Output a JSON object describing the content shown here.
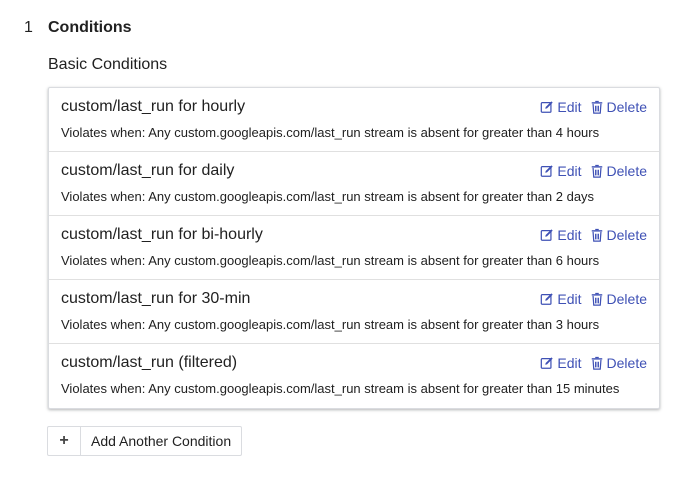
{
  "section": {
    "number": "1",
    "title": "Conditions"
  },
  "subheading": "Basic Conditions",
  "conditions": [
    {
      "name": "custom/last_run for hourly",
      "description": "Violates when: Any custom.googleapis.com/last_run stream is absent for greater than 4 hours"
    },
    {
      "name": "custom/last_run for daily",
      "description": "Violates when: Any custom.googleapis.com/last_run stream is absent for greater than 2 days"
    },
    {
      "name": "custom/last_run for bi-hourly",
      "description": "Violates when: Any custom.googleapis.com/last_run stream is absent for greater than 6 hours"
    },
    {
      "name": "custom/last_run for 30-min",
      "description": "Violates when: Any custom.googleapis.com/last_run stream is absent for greater than 3 hours"
    },
    {
      "name": "custom/last_run (filtered)",
      "description": "Violates when: Any custom.googleapis.com/last_run stream is absent for greater than 15 minutes"
    }
  ],
  "actions": {
    "edit_label": "Edit",
    "delete_label": "Delete",
    "edit_icon": "pencil-square-icon",
    "delete_icon": "trash-icon"
  },
  "add_button": {
    "icon": "+",
    "label": "Add Another Condition"
  },
  "colors": {
    "link": "#3f51b5",
    "text": "#212121",
    "border": "#dadce0"
  }
}
